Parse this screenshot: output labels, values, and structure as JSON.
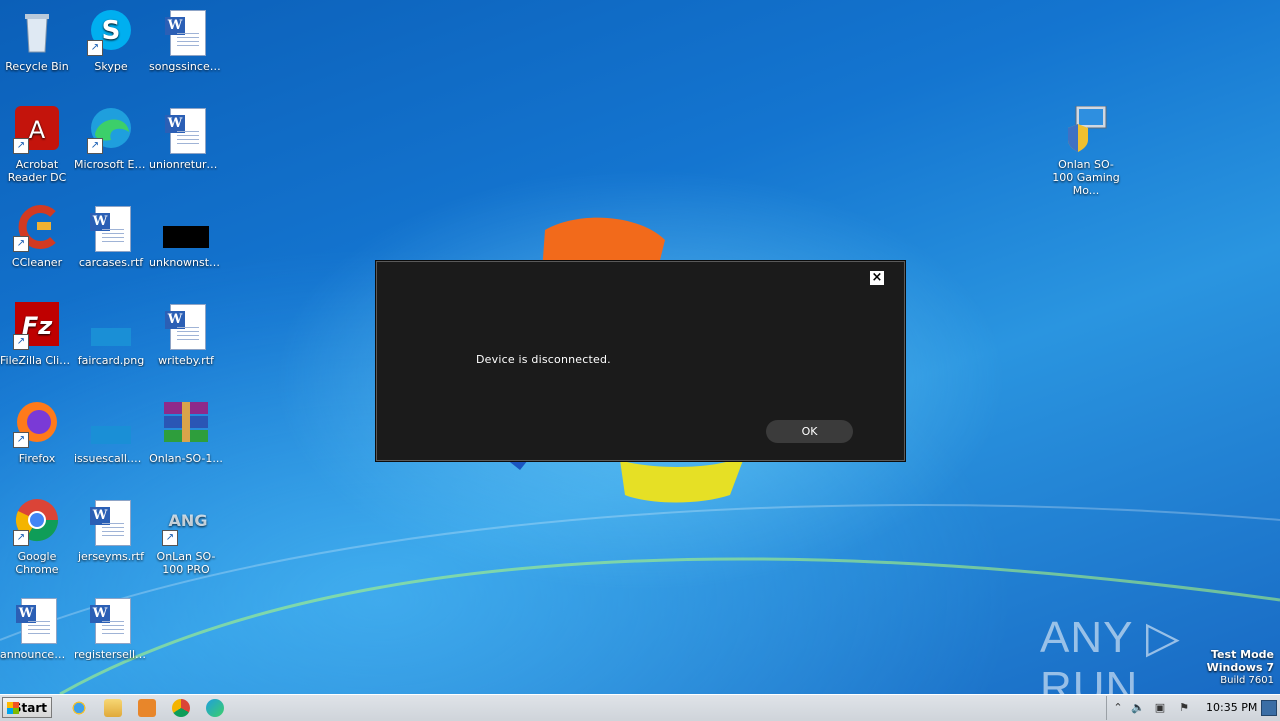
{
  "desktop": {
    "icons": [
      {
        "label": "Recycle Bin",
        "icon": "recycle-bin-icon"
      },
      {
        "label": "Skype",
        "icon": "skype-icon"
      },
      {
        "label": "songssince.rtf",
        "icon": "word-doc-icon"
      },
      {
        "label": "Acrobat Reader DC",
        "icon": "acrobat-icon"
      },
      {
        "label": "Microsoft Edge",
        "icon": "edge-icon"
      },
      {
        "label": "unionreturn....",
        "icon": "word-doc-icon"
      },
      {
        "label": "CCleaner",
        "icon": "ccleaner-icon"
      },
      {
        "label": "carcases.rtf",
        "icon": "word-doc-icon"
      },
      {
        "label": "unknownsta...",
        "icon": "image-file-icon"
      },
      {
        "label": "FileZilla Client",
        "icon": "filezilla-icon"
      },
      {
        "label": "faircard.png",
        "icon": "image-file-icon"
      },
      {
        "label": "writeby.rtf",
        "icon": "word-doc-icon"
      },
      {
        "label": "Firefox",
        "icon": "firefox-icon"
      },
      {
        "label": "issuescall.png",
        "icon": "image-file-icon"
      },
      {
        "label": "Onlan-SO-1...",
        "icon": "winrar-icon"
      },
      {
        "label": "Google Chrome",
        "icon": "chrome-icon"
      },
      {
        "label": "jerseyms.rtf",
        "icon": "word-doc-icon"
      },
      {
        "label": "OnLan SO-100 PRO",
        "icon": "onlan-icon"
      },
      {
        "label": "announcem...",
        "icon": "word-doc-icon"
      },
      {
        "label": "registersell.rtf",
        "icon": "word-doc-icon"
      },
      {
        "label": "Onlan SO-100 Gaming Mo...",
        "icon": "installer-icon"
      }
    ]
  },
  "dialog": {
    "message": "Device is disconnected.",
    "ok_label": "OK",
    "close_glyph": "×"
  },
  "watermark": {
    "text": "ANY ▷ RUN"
  },
  "test_mode": {
    "line1": "Test Mode",
    "line2": "Windows 7",
    "line3": "Build 7601"
  },
  "taskbar": {
    "start_label": "Start",
    "pinned": [
      "ie-icon",
      "explorer-icon",
      "media-player-icon",
      "chrome-icon",
      "edge-icon"
    ],
    "tray": {
      "clock": "10:35 PM",
      "icons": [
        "show-hidden-icon",
        "volume-icon",
        "network-icon",
        "action-center-flag-icon"
      ]
    }
  }
}
